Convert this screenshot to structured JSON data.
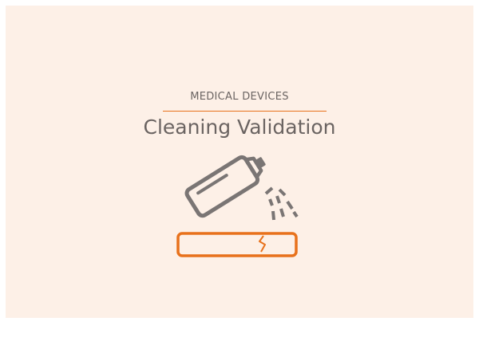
{
  "header": {
    "eyebrow": "MEDICAL DEVICES",
    "title": "Cleaning Validation"
  },
  "colors": {
    "background": "#fdf0e7",
    "text": "#6b6462",
    "accent": "#e8711b",
    "icon_stroke": "#7a7574"
  },
  "icons": {
    "spray_can": "spray-can-icon",
    "spray_mist": "spray-mist-icon",
    "cracked_surface": "cracked-surface-icon"
  }
}
